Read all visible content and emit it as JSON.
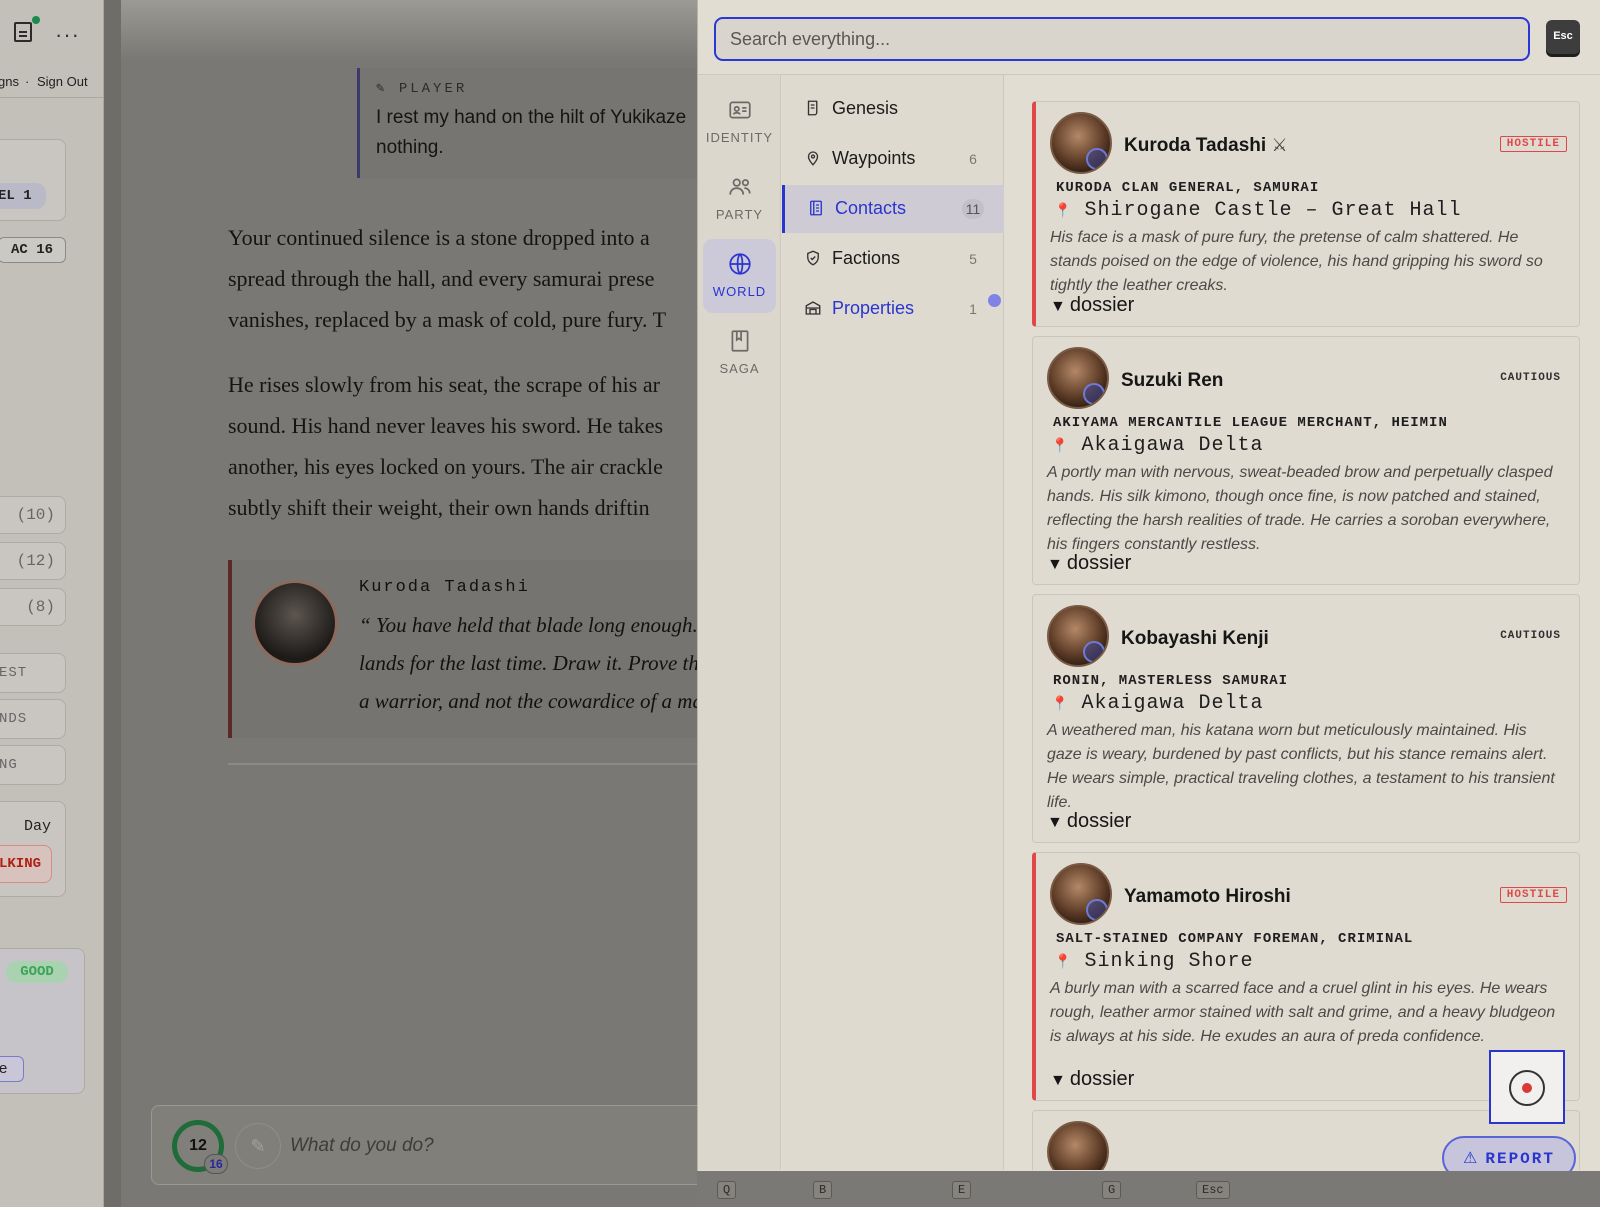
{
  "left_sidebar": {
    "links": [
      "gns",
      "·",
      "Sign Out"
    ],
    "level": "EL 1",
    "ac": "AC 16",
    "stats": [
      "(10)",
      "(12)",
      "(8)"
    ],
    "actions": [
      "EST",
      "NDS",
      "NG"
    ],
    "day": "Day",
    "status": "LKING",
    "mood": "GOOD",
    "tag": "e"
  },
  "main": {
    "player_label": "PLAYER",
    "player_text": "I rest my hand on the hilt of Yukikaze nothing.",
    "paragraphs": [
      [
        "Your continued silence is a stone dropped into a",
        "spread through the hall, and every samurai prese",
        "vanishes, replaced by a mask of cold, pure fury. T"
      ],
      [
        "He rises slowly from his seat, the scrape of his ar",
        "sound. His hand never leaves his sword. He takes",
        "another, his eyes locked on yours. The air crackle",
        "subtly shift their weight, their own hands driftin"
      ]
    ],
    "npc_name": "Kuroda Tadashi",
    "npc_quote": "“ You have held that blade long enough.\nlands for the last time. Draw it. Prove th\na warrior, and not the cowardice of a ma",
    "hp": "12",
    "hp_max": "16",
    "action_placeholder": "What do you do?"
  },
  "panel": {
    "search_placeholder": "Search everything...",
    "esc_label": "Esc",
    "rail": [
      {
        "label": "IDENTITY",
        "icon": "id-card-icon"
      },
      {
        "label": "PARTY",
        "icon": "users-icon"
      },
      {
        "label": "WORLD",
        "icon": "globe-icon"
      },
      {
        "label": "SAGA",
        "icon": "book-icon"
      }
    ],
    "subnav": [
      {
        "label": "Genesis",
        "count": "",
        "icon": "scroll-icon"
      },
      {
        "label": "Waypoints",
        "count": "6",
        "icon": "map-pin-icon"
      },
      {
        "label": "Contacts",
        "count": "11",
        "icon": "contacts-book-icon"
      },
      {
        "label": "Factions",
        "count": "5",
        "icon": "shield-icon"
      },
      {
        "label": "Properties",
        "count": "1",
        "icon": "house-icon"
      }
    ],
    "contacts": [
      {
        "name": "Kuroda Tadashi",
        "swords": "⚔",
        "tag": "HOSTILE",
        "role": "KURODA CLAN GENERAL, SAMURAI",
        "location": "Shirogane Castle – Great Hall",
        "description": "His face is a mask of pure fury, the pretense of calm shattered. He stands poised on the edge of violence, his hand gripping his sword so tightly the leather creaks.",
        "dossier": "dossier"
      },
      {
        "name": "Suzuki Ren",
        "swords": "",
        "tag": "CAUTIOUS",
        "role": "AKIYAMA MERCANTILE LEAGUE MERCHANT, HEIMIN",
        "location": "Akaigawa Delta",
        "description": "A portly man with nervous, sweat-beaded brow and perpetually clasped hands. His silk kimono, though once fine, is now patched and stained, reflecting the harsh realities of trade. He carries a soroban everywhere, his fingers constantly restless.",
        "dossier": "dossier"
      },
      {
        "name": "Kobayashi Kenji",
        "swords": "",
        "tag": "CAUTIOUS",
        "role": "RONIN, MASTERLESS SAMURAI",
        "location": "Akaigawa Delta",
        "description": "A weathered man, his katana worn but meticulously maintained. His gaze is weary, burdened by past conflicts, but his stance remains alert. He wears simple, practical traveling clothes, a testament to his transient life.",
        "dossier": "dossier"
      },
      {
        "name": "Yamamoto Hiroshi",
        "swords": "",
        "tag": "HOSTILE",
        "role": "SALT-STAINED COMPANY FOREMAN, CRIMINAL",
        "location": "Sinking Shore",
        "description": "A burly man with a scarred face and a cruel glint in his eyes. He wears rough, leather armor stained with salt and grime, and a heavy bludgeon is always at his side. He exudes an aura of preda confidence.",
        "dossier": "dossier"
      }
    ],
    "report_label": "REPORT",
    "shortcut_keys": [
      "Q",
      "B",
      "E",
      "G",
      "Esc"
    ]
  }
}
